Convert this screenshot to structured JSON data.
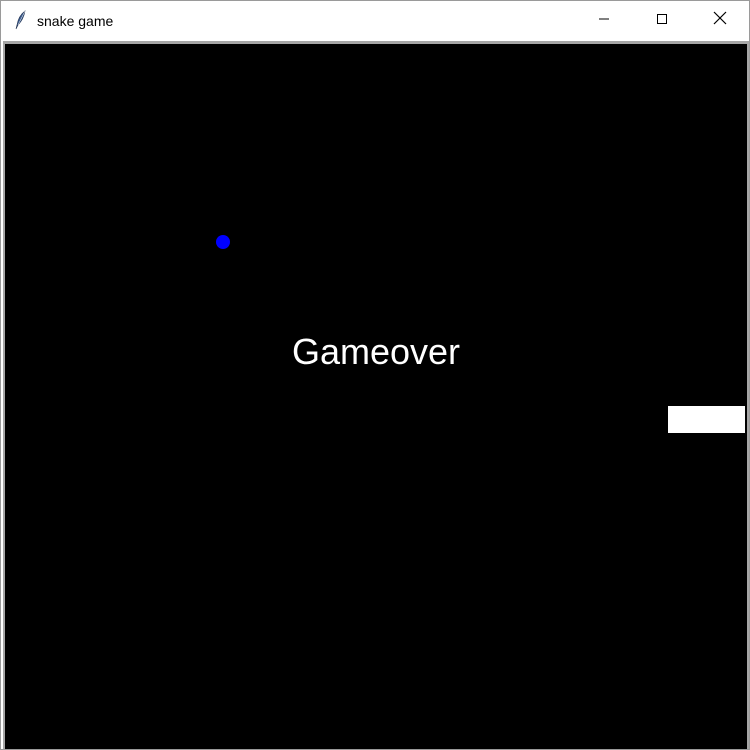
{
  "window": {
    "title": "snake game",
    "app_icon": "feather-icon",
    "controls": {
      "minimize_icon": "minimize-icon",
      "maximize_icon": "maximize-icon",
      "close_icon": "close-icon"
    }
  },
  "game": {
    "status_text": "Gameover",
    "colors": {
      "background": "#000000",
      "food": "#0000ff",
      "snake": "#ffffff",
      "text": "#ffffff"
    }
  }
}
